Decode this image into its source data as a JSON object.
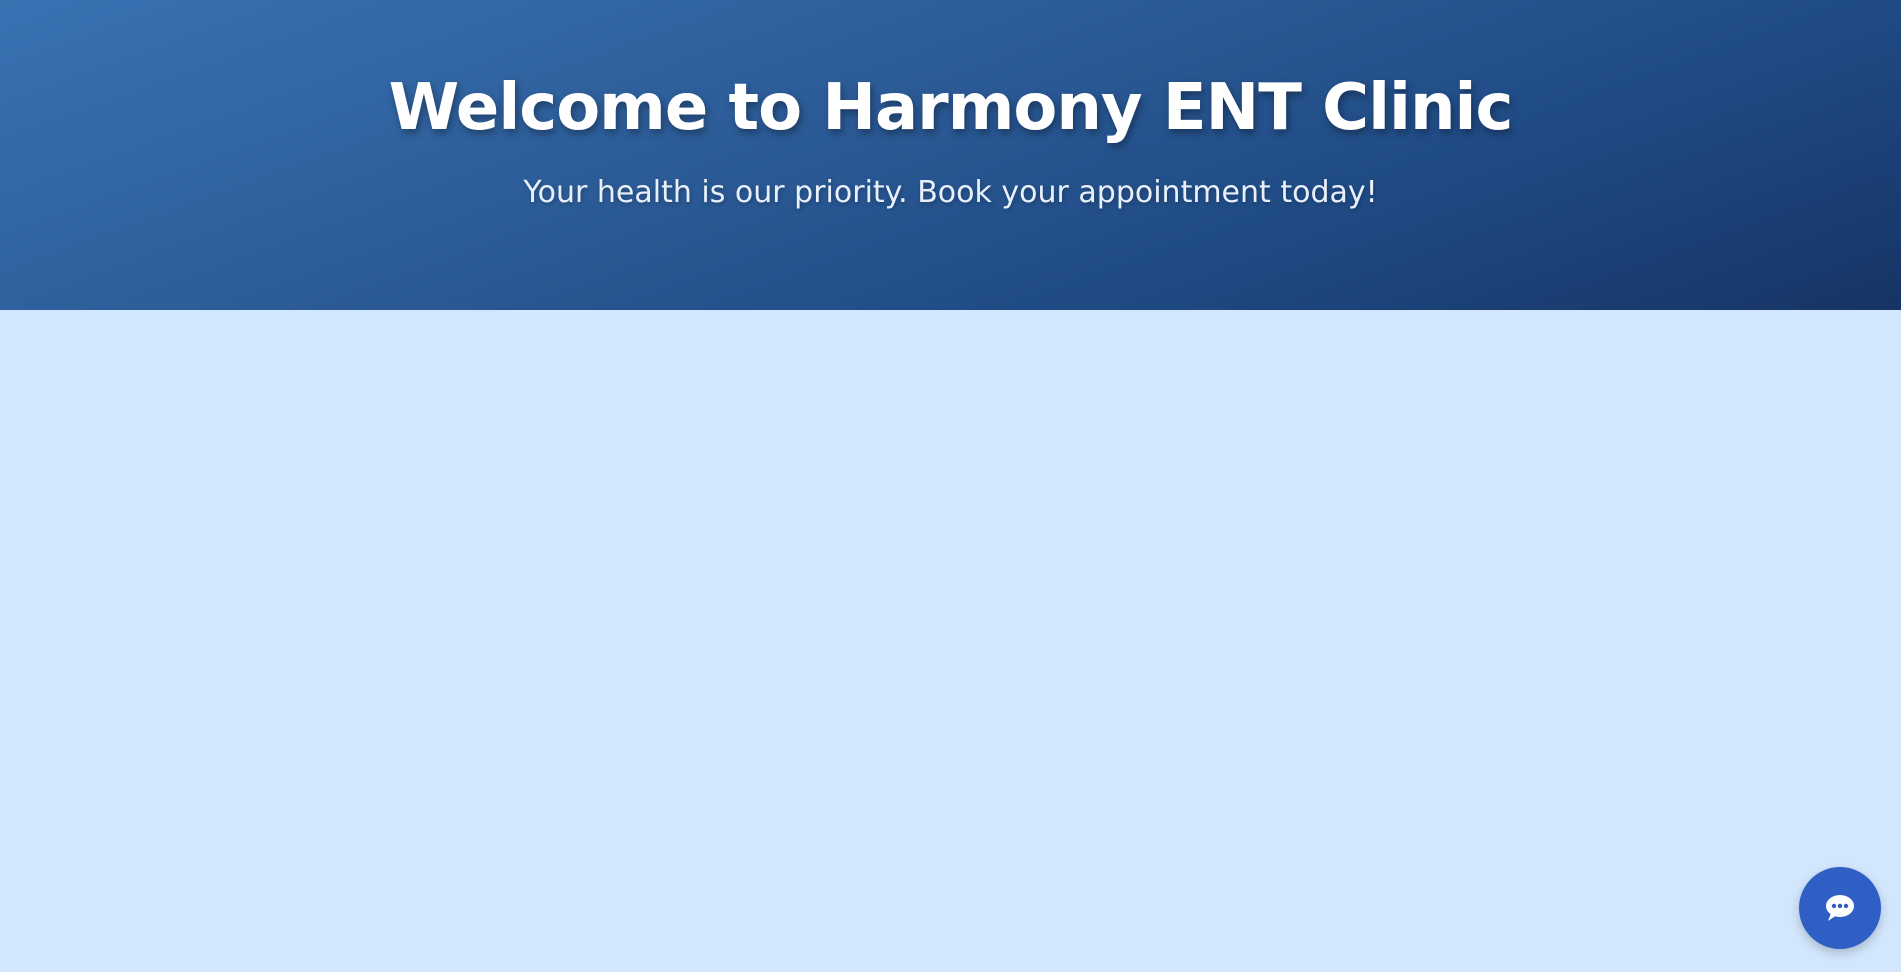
{
  "hero": {
    "title": "Welcome to Harmony ENT Clinic",
    "subtitle": "Your health is our priority. Book your appointment today!"
  },
  "chat_widget": {
    "icon": "chat-bubble-icon"
  },
  "colors": {
    "hero_gradient_start": "#3a72b3",
    "hero_gradient_end": "#163465",
    "page_background": "#d2e6fd",
    "chat_button": "#2f5fc4"
  }
}
